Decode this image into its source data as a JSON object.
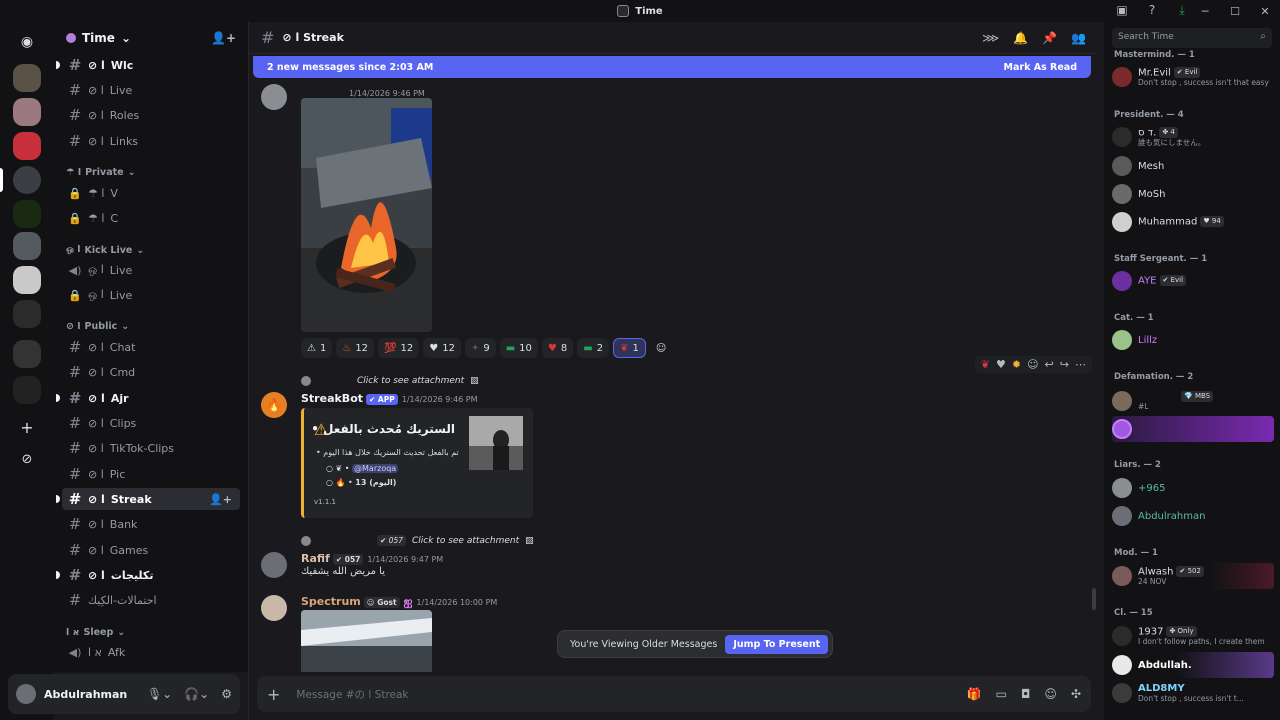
{
  "window": {
    "title": "Time"
  },
  "colors": {
    "accent": "#5865f2",
    "embed_bar": "#f0b232",
    "bg": "#1a1a1e",
    "sidebar": "#121214"
  },
  "server": {
    "name": "Time"
  },
  "channels": {
    "wlc": "Wlc",
    "live1": "Live",
    "roles": "Roles",
    "links": "Links",
    "cat_private": "Private",
    "v": "V",
    "c": "C",
    "cat_kick": "Kick Live",
    "live2": "Live",
    "live3": "Live",
    "cat_public": "Public",
    "chat": "Chat",
    "cmd": "Cmd",
    "ajr": "Ajr",
    "clips": "Clips",
    "tiktok": "TikTok-Clips",
    "pic": "Pic",
    "streak": "Streak",
    "bank": "Bank",
    "games": "Games",
    "takhleefat": "تكليجات",
    "ihtmalat": "احتمالات-الكِيك",
    "cat_sleep": "Sleep",
    "afk": "Afk"
  },
  "user": {
    "name": "Abdulrahman"
  },
  "header": {
    "channel_name": "Streak"
  },
  "banner": {
    "text": "2 new messages since 2:03 AM",
    "action": "Mark As Read"
  },
  "messages": {
    "m1": {
      "time": "1/14/2026 9:46 PM"
    },
    "reactions": [
      "1",
      "12",
      "12",
      "12",
      "9",
      "10",
      "8",
      "2",
      "1"
    ],
    "reply1": "Click to see attachment",
    "m2": {
      "author": "StreakBot",
      "badge": "APP",
      "time": "1/14/2026 9:46 PM"
    },
    "embed": {
      "title": "الستريك مُحدث بالفعل •",
      "line1": "تم بالفعل تحديث الستريك خلال هذا اليوم",
      "mention": "@Marzoqa",
      "count_line": "13 (اليوم)",
      "version": "v1.1.1"
    },
    "reply2": "Click to see attachment",
    "reply2_tag": "057",
    "m3": {
      "author": "Rafif",
      "badge": "057",
      "time": "1/14/2026 9:47 PM",
      "text": "يا مريض الله يشفيك"
    },
    "m4": {
      "author": "Spectrum",
      "badge": "Gost",
      "time": "1/14/2026 10:00 PM"
    }
  },
  "older": {
    "text": "You're Viewing Older Messages",
    "jump": "Jump To Present"
  },
  "composer": {
    "placeholder": "Message #の ا Streak"
  },
  "members": {
    "search_placeholder": "Search Time",
    "g0": "Mastermind. — 1",
    "mrevil": {
      "name": "Mr.Evil",
      "tag": "Evil",
      "status": "Don't stop , success isn't that easy"
    },
    "g1": "President. — 4",
    "p1": {
      "name": "ד ס.",
      "tag": "4",
      "status": "誰も気にしません。"
    },
    "p2": {
      "name": "Mesh"
    },
    "p3": {
      "name": "MoSh"
    },
    "p4": {
      "name": "Muhammad",
      "tag": "94"
    },
    "g2": "Staff Sergeant. — 1",
    "aye": {
      "name": "AYE",
      "tag": "Evil"
    },
    "g3": "Cat. — 1",
    "cat1": {
      "name": "Lillz"
    },
    "g4": "Defamation. — 2",
    "d1": {
      "tag": "MBS",
      "status": "#L"
    },
    "g5": "Liars. — 2",
    "l1": {
      "name": "+965"
    },
    "l2": {
      "name": "Abdulrahman"
    },
    "g6": "Mod. — 1",
    "mod1": {
      "name": "Alwash",
      "tag": "502",
      "status": "24 NOV"
    },
    "g7": "Cl. — 15",
    "c1": {
      "name": "1937",
      "tag": "Only",
      "status": "I don't follow paths, I create them"
    },
    "c2": {
      "name": "Abdullah."
    },
    "c3": {
      "name": "ALD8MY",
      "status": "Don't stop , success isn't t..."
    }
  }
}
